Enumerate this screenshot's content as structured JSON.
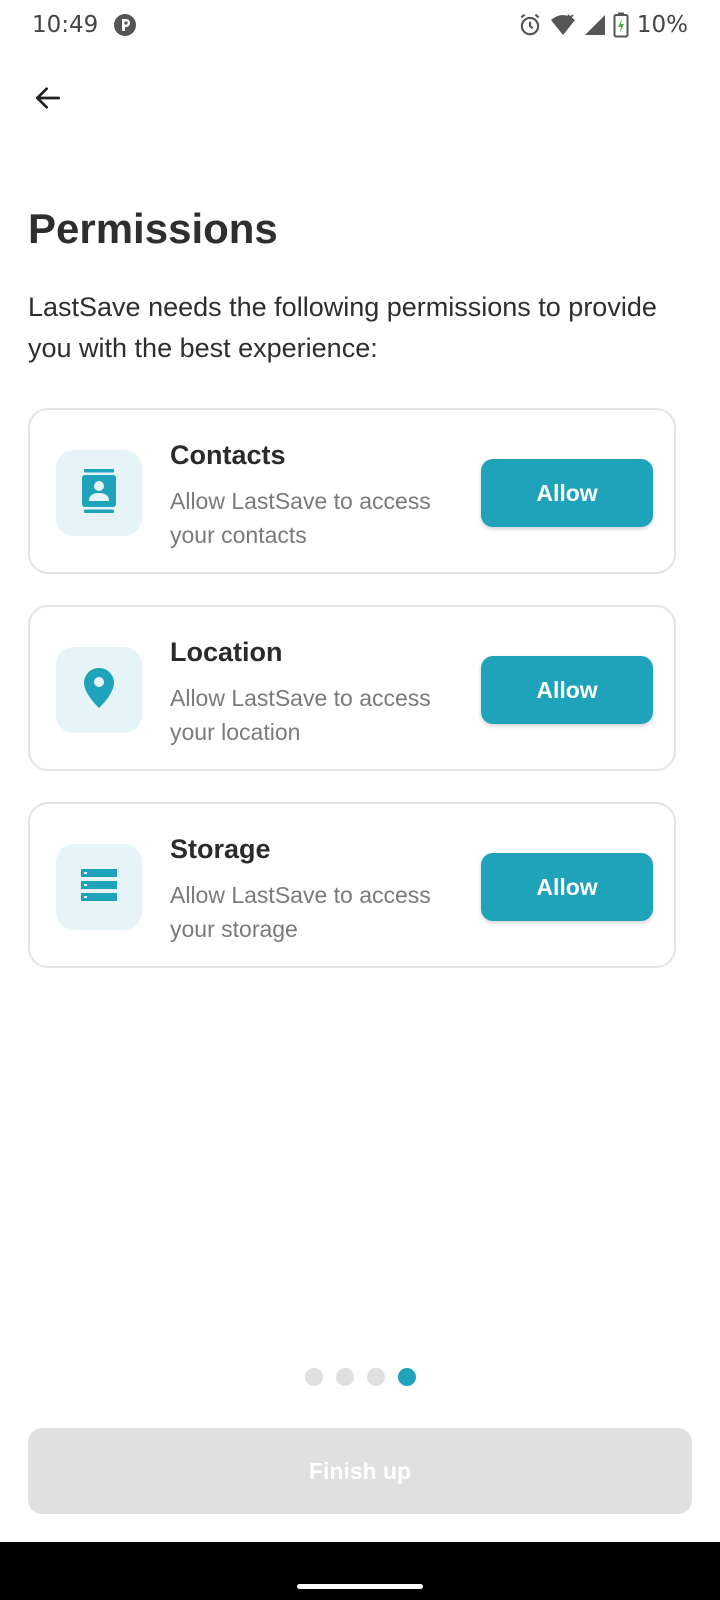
{
  "status_bar": {
    "time": "10:49",
    "battery_percent": "10%",
    "icons": [
      "app-notification-icon",
      "alarm-icon",
      "wifi-icon",
      "signal-icon",
      "battery-icon"
    ]
  },
  "header": {
    "back_icon": "arrow-left-icon"
  },
  "main": {
    "title": "Permissions",
    "description": "LastSave needs the following permissions to provide you with the best experience:",
    "permissions": [
      {
        "icon": "contacts-icon",
        "title": "Contacts",
        "description": "Allow LastSave to access your contacts",
        "button_label": "Allow"
      },
      {
        "icon": "location-pin-icon",
        "title": "Location",
        "description": "Allow LastSave to access your location",
        "button_label": "Allow"
      },
      {
        "icon": "storage-icon",
        "title": "Storage",
        "description": "Allow LastSave to access your storage",
        "button_label": "Allow"
      }
    ]
  },
  "pagination": {
    "total_pages": 4,
    "current_page": 4
  },
  "footer": {
    "finish_label": "Finish up",
    "finish_enabled": false
  },
  "colors": {
    "accent": "#1fa3bb",
    "icon_background": "#e6f4f8",
    "disabled_button": "#e0e0e0"
  }
}
